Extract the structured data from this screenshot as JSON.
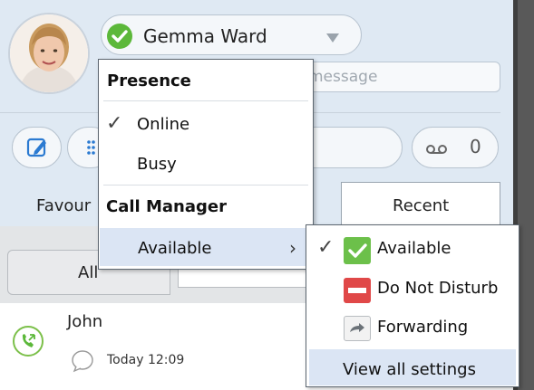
{
  "user": {
    "name": "Gemma Ward",
    "status": "online",
    "status_color": "#5cb83a"
  },
  "status_message": {
    "placeholder_visible": "message"
  },
  "toolbar": {
    "voicemail_count": "0"
  },
  "tabs": [
    {
      "label": "Favour",
      "selected": false
    },
    {
      "label": "Recent",
      "selected": true
    }
  ],
  "filters": {
    "all_label": "All"
  },
  "recent_list": [
    {
      "name": "John",
      "time": "Today 12:09",
      "type": "incoming-call"
    }
  ],
  "presence_menu": {
    "heading": "Presence",
    "items": [
      {
        "label": "Online",
        "checked": true
      },
      {
        "label": "Busy",
        "checked": false
      }
    ],
    "call_manager_heading": "Call Manager",
    "call_manager_item": {
      "label": "Available",
      "has_submenu": true
    }
  },
  "call_manager_submenu": {
    "items": [
      {
        "label": "Available",
        "checked": true,
        "icon": "available-check-icon",
        "color": "#6cc04a"
      },
      {
        "label": "Do Not Disturb",
        "checked": false,
        "icon": "do-not-disturb-icon",
        "color": "#e04848"
      },
      {
        "label": "Forwarding",
        "checked": false,
        "icon": "forwarding-icon"
      }
    ],
    "view_all_label": "View all settings"
  },
  "colors": {
    "header_bg": "#dfe9f3",
    "menu_highlight": "#dbe5f4",
    "accent_green": "#7cc04a"
  }
}
